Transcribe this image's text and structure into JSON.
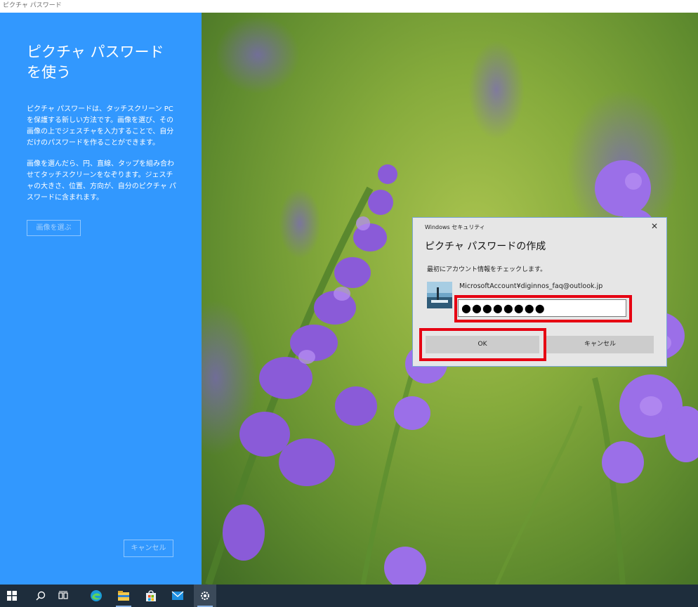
{
  "window": {
    "title": "ピクチャ パスワード"
  },
  "left_panel": {
    "heading": "ピクチャ パスワードを使う",
    "description1": "ピクチャ パスワードは、タッチスクリーン PC を保護する新しい方法です。画像を選び、その画像の上でジェスチャを入力することで、自分だけのパスワードを作ることができます。",
    "description2": "画像を選んだら、円、直線、タップを組み合わせてタッチスクリーンをなぞります。ジェスチャの大きさ、位置、方向が、自分のピクチャ パスワードに含まれます。",
    "choose_image_button": "画像を選ぶ",
    "cancel_button": "キャンセル"
  },
  "dialog": {
    "header": "Windows セキュリティ",
    "close_glyph": "✕",
    "title": "ピクチャ パスワードの作成",
    "subtitle": "最初にアカウント情報をチェックします。",
    "account": "MicrosoftAccount¥diginnos_faq@outlook.jp",
    "password_masked": "●●●●●●●●",
    "ok_button": "OK",
    "cancel_button": "キャンセル"
  },
  "taskbar": {
    "icons": [
      "windows-start-icon",
      "search-icon",
      "task-view-icon",
      "edge-icon",
      "file-explorer-icon",
      "store-icon",
      "mail-icon",
      "settings-icon"
    ]
  },
  "colors": {
    "accent": "#3298fe",
    "highlight": "#e60012",
    "taskbar": "#1e2d3c"
  }
}
